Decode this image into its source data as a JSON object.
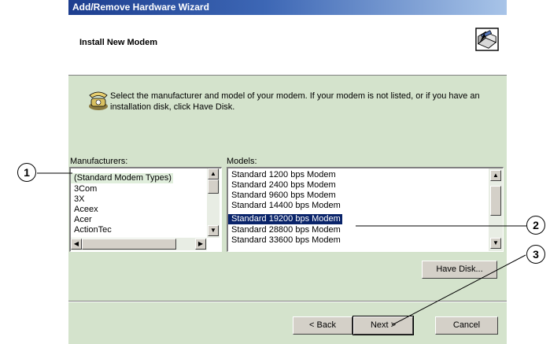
{
  "window": {
    "title": "Add/Remove Hardware Wizard"
  },
  "header": {
    "title": "Install New Modem",
    "icon": "hardware-wizard-icon"
  },
  "instructions": "Select the manufacturer and model of your modem. If your modem is not listed, or if you have an installation disk, click Have Disk.",
  "manufacturers": {
    "label": "Manufacturers:",
    "items": [
      "(Standard Modem Types)",
      "3Com",
      "3X",
      "Aceex",
      "Acer",
      "ActionTec"
    ],
    "selected": "(Standard Modem Types)"
  },
  "models": {
    "label": "Models:",
    "items": [
      "Standard  1200 bps Modem",
      "Standard  2400 bps Modem",
      "Standard  9600 bps Modem",
      "Standard 14400 bps Modem",
      "Standard 19200 bps Modem",
      "Standard 28800 bps Modem",
      "Standard 33600 bps Modem"
    ],
    "selected": "Standard 19200 bps Modem"
  },
  "buttons": {
    "have_disk": "Have Disk...",
    "back": "< Back",
    "next": "Next >",
    "cancel": "Cancel"
  },
  "callouts": [
    "1",
    "2",
    "3"
  ],
  "colors": {
    "dialog_bg": "#d4e3cc",
    "selection": "#0a246a",
    "titlebar": "#1d3e8f"
  }
}
